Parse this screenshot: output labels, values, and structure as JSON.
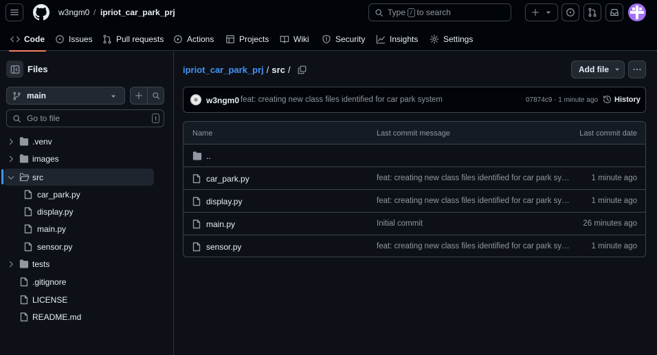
{
  "header": {
    "owner": "w3ngm0",
    "separator": "/",
    "repo": "ipriot_car_park_prj",
    "search_prefix": "Type",
    "search_key": "/",
    "search_suffix": "to search"
  },
  "tabs": [
    {
      "label": "Code",
      "icon": "code-icon",
      "active": true
    },
    {
      "label": "Issues",
      "icon": "issue-icon"
    },
    {
      "label": "Pull requests",
      "icon": "pull-request-icon"
    },
    {
      "label": "Actions",
      "icon": "play-icon"
    },
    {
      "label": "Projects",
      "icon": "table-icon"
    },
    {
      "label": "Wiki",
      "icon": "book-icon"
    },
    {
      "label": "Security",
      "icon": "shield-icon"
    },
    {
      "label": "Insights",
      "icon": "graph-icon"
    },
    {
      "label": "Settings",
      "icon": "gear-icon"
    }
  ],
  "sidebar": {
    "title": "Files",
    "branch": "main",
    "goto_placeholder": "Go to file",
    "goto_key": "t",
    "tree": [
      {
        "label": ".venv",
        "type": "folder",
        "expanded": false
      },
      {
        "label": "images",
        "type": "folder",
        "expanded": false
      },
      {
        "label": "src",
        "type": "folder",
        "expanded": true,
        "selected": true
      },
      {
        "label": "car_park.py",
        "type": "file"
      },
      {
        "label": "display.py",
        "type": "file"
      },
      {
        "label": "main.py",
        "type": "file"
      },
      {
        "label": "sensor.py",
        "type": "file"
      },
      {
        "label": "tests",
        "type": "folder",
        "expanded": false
      },
      {
        "label": ".gitignore",
        "type": "file"
      },
      {
        "label": "LICENSE",
        "type": "file"
      },
      {
        "label": "README.md",
        "type": "file"
      }
    ]
  },
  "breadcrumb": {
    "repo": "ipriot_car_park_prj",
    "sep1": "/",
    "current": "src",
    "sep2": "/"
  },
  "actions": {
    "add_file": "Add file"
  },
  "commit": {
    "author": "w3ngm0",
    "message": "feat: creating new class files identified for car park system",
    "meta": "07874c9 · 1 minute ago",
    "history": "History"
  },
  "table": {
    "headers": {
      "name": "Name",
      "message": "Last commit message",
      "date": "Last commit date"
    },
    "rows": [
      {
        "name": "..",
        "type": "folder",
        "message": "",
        "date": ""
      },
      {
        "name": "car_park.py",
        "type": "file",
        "message": "feat: creating new class files identified for car park system",
        "date": "1 minute ago"
      },
      {
        "name": "display.py",
        "type": "file",
        "message": "feat: creating new class files identified for car park system",
        "date": "1 minute ago"
      },
      {
        "name": "main.py",
        "type": "file",
        "message": "Initial commit",
        "date": "26 minutes ago"
      },
      {
        "name": "sensor.py",
        "type": "file",
        "message": "feat: creating new class files identified for car park system",
        "date": "1 minute ago"
      }
    ]
  },
  "colors": {
    "background": "#0d1117",
    "header": "#010409",
    "accent": "#4493f8",
    "active_tab_underline": "#f78166",
    "folder": "#9198a1"
  }
}
